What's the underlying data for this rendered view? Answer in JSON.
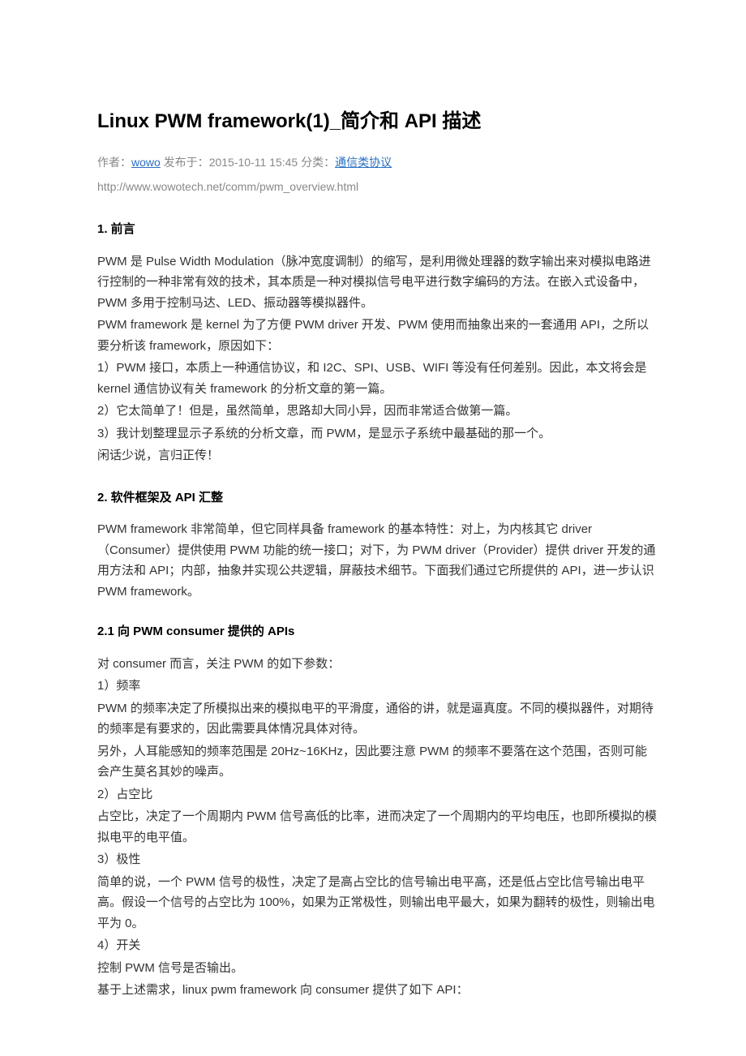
{
  "title": "Linux PWM framework(1)_简介和 API 描述",
  "meta": {
    "author_label": "作者：",
    "author": "wowo",
    "pub_label": " 发布于：",
    "pub_time": "2015-10-11 15:45",
    "cat_label": " 分类：",
    "category": "通信类协议"
  },
  "url": "http://www.wowotech.net/comm/pwm_overview.html",
  "s1": {
    "heading": "1.  前言",
    "p1": "PWM 是 Pulse Width Modulation（脉冲宽度调制）的缩写，是利用微处理器的数字输出来对模拟电路进行控制的一种非常有效的技术，其本质是一种对模拟信号电平进行数字编码的方法。在嵌入式设备中，PWM 多用于控制马达、LED、振动器等模拟器件。",
    "p2": "PWM framework 是 kernel 为了方便 PWM driver 开发、PWM 使用而抽象出来的一套通用 API，之所以要分析该 framework，原因如下：",
    "p3": "1）PWM 接口，本质上一种通信协议，和 I2C、SPI、USB、WIFI 等没有任何差别。因此，本文将会是 kernel 通信协议有关 framework 的分析文章的第一篇。",
    "p4": "2）它太简单了！但是，虽然简单，思路却大同小异，因而非常适合做第一篇。",
    "p5": "3）我计划整理显示子系统的分析文章，而 PWM，是显示子系统中最基础的那一个。",
    "p6": "闲话少说，言归正传！"
  },
  "s2": {
    "heading": "2.  软件框架及 API 汇整",
    "p1": "PWM framework 非常简单，但它同样具备 framework 的基本特性：对上，为内核其它 driver（Consumer）提供使用 PWM 功能的统一接口；对下，为 PWM driver（Provider）提供 driver 开发的通用方法和 API；内部，抽象并实现公共逻辑，屏蔽技术细节。下面我们通过它所提供的 API，进一步认识 PWM framework。"
  },
  "s21": {
    "heading": "2.1  向 PWM consumer 提供的 APIs",
    "p1": "对 consumer 而言，关注 PWM 的如下参数：",
    "p2": "1）频率",
    "p3": "PWM 的频率决定了所模拟出来的模拟电平的平滑度，通俗的讲，就是逼真度。不同的模拟器件，对期待的频率是有要求的，因此需要具体情况具体对待。",
    "p4": "另外，人耳能感知的频率范围是 20Hz~16KHz，因此要注意 PWM 的频率不要落在这个范围，否则可能会产生莫名其妙的噪声。",
    "p5": "2）占空比",
    "p6": "占空比，决定了一个周期内 PWM 信号高低的比率，进而决定了一个周期内的平均电压，也即所模拟的模拟电平的电平值。",
    "p7": "3）极性",
    "p8": "简单的说，一个 PWM 信号的极性，决定了是高占空比的信号输出电平高，还是低占空比信号输出电平高。假设一个信号的占空比为 100%，如果为正常极性，则输出电平最大，如果为翻转的极性，则输出电平为 0。",
    "p9": "4）开关",
    "p10": "控制 PWM 信号是否输出。",
    "p11": "基于上述需求，linux pwm framework 向 consumer 提供了如下 API："
  }
}
